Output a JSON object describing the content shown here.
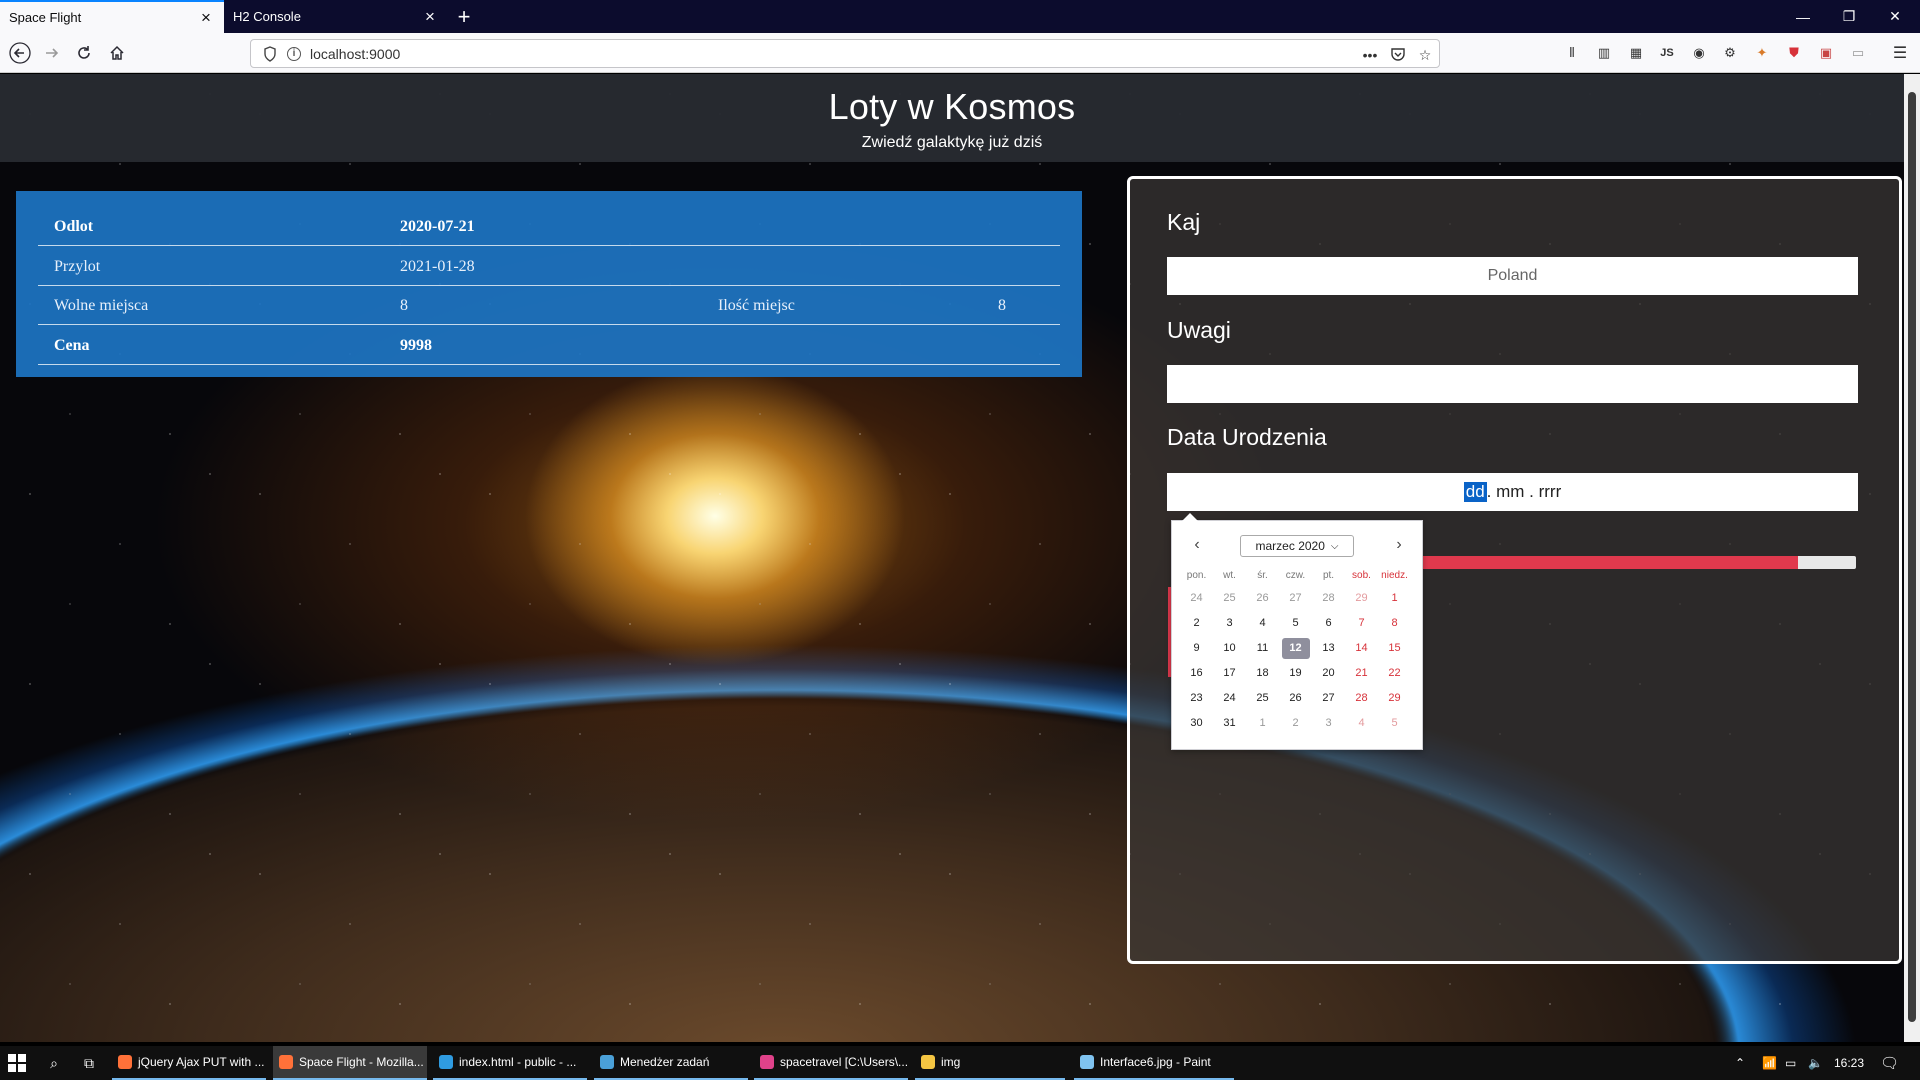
{
  "browser": {
    "tabs": [
      {
        "title": "Space Flight",
        "active": true
      },
      {
        "title": "H2 Console",
        "active": false
      }
    ],
    "url": "localhost:9000"
  },
  "page": {
    "title": "Loty w Kosmos",
    "subtitle": "Zwiedź galaktykę już dziś"
  },
  "flight": {
    "departure_label": "Odlot",
    "departure_value": "2020-07-21",
    "arrival_label": "Przylot",
    "arrival_value": "2021-01-28",
    "free_seats_label": "Wolne miejsca",
    "free_seats_value": "8",
    "seats_label": "Ilość miejsc",
    "seats_value": "8",
    "price_label": "Cena",
    "price_value": "9998"
  },
  "form": {
    "country_label": "Kaj",
    "country_value": "Poland",
    "notes_label": "Uwagi",
    "notes_value": "",
    "birth_label": "Data Urodzenia",
    "date_dd": "dd",
    "date_rest": ". mm . rrrr",
    "progress_fraction": 0.87
  },
  "datepicker": {
    "month": "marzec 2020",
    "weekdays": [
      "pon.",
      "wt.",
      "śr.",
      "czw.",
      "pt.",
      "sob.",
      "niedz."
    ],
    "weeks": [
      [
        "24",
        "25",
        "26",
        "27",
        "28",
        "29",
        "1"
      ],
      [
        "2",
        "3",
        "4",
        "5",
        "6",
        "7",
        "8"
      ],
      [
        "9",
        "10",
        "11",
        "12",
        "13",
        "14",
        "15"
      ],
      [
        "16",
        "17",
        "18",
        "19",
        "20",
        "21",
        "22"
      ],
      [
        "23",
        "24",
        "25",
        "26",
        "27",
        "28",
        "29"
      ],
      [
        "30",
        "31",
        "1",
        "2",
        "3",
        "4",
        "5"
      ]
    ],
    "today": "12"
  },
  "taskbar": {
    "apps": [
      {
        "label": "jQuery Ajax PUT with ...",
        "icon": "firefox-icon",
        "color": "#ff7139",
        "active": false
      },
      {
        "label": "Space Flight - Mozilla...",
        "icon": "firefox-icon",
        "color": "#ff7139",
        "active": true
      },
      {
        "label": "index.html - public - ...",
        "icon": "vscode-icon",
        "color": "#2f9be0",
        "active": false
      },
      {
        "label": "Menedżer zadań",
        "icon": "task-manager-icon",
        "color": "#4aa0d8",
        "active": false
      },
      {
        "label": "spacetravel [C:\\Users\\...",
        "icon": "intellij-icon",
        "color": "#e0428a",
        "active": false
      },
      {
        "label": "img",
        "icon": "folder-icon",
        "color": "#f4c542",
        "active": false
      },
      {
        "label": "Interface6.jpg - Paint",
        "icon": "paint-icon",
        "color": "#7fc3f0",
        "active": false
      }
    ],
    "time": "16:23"
  }
}
